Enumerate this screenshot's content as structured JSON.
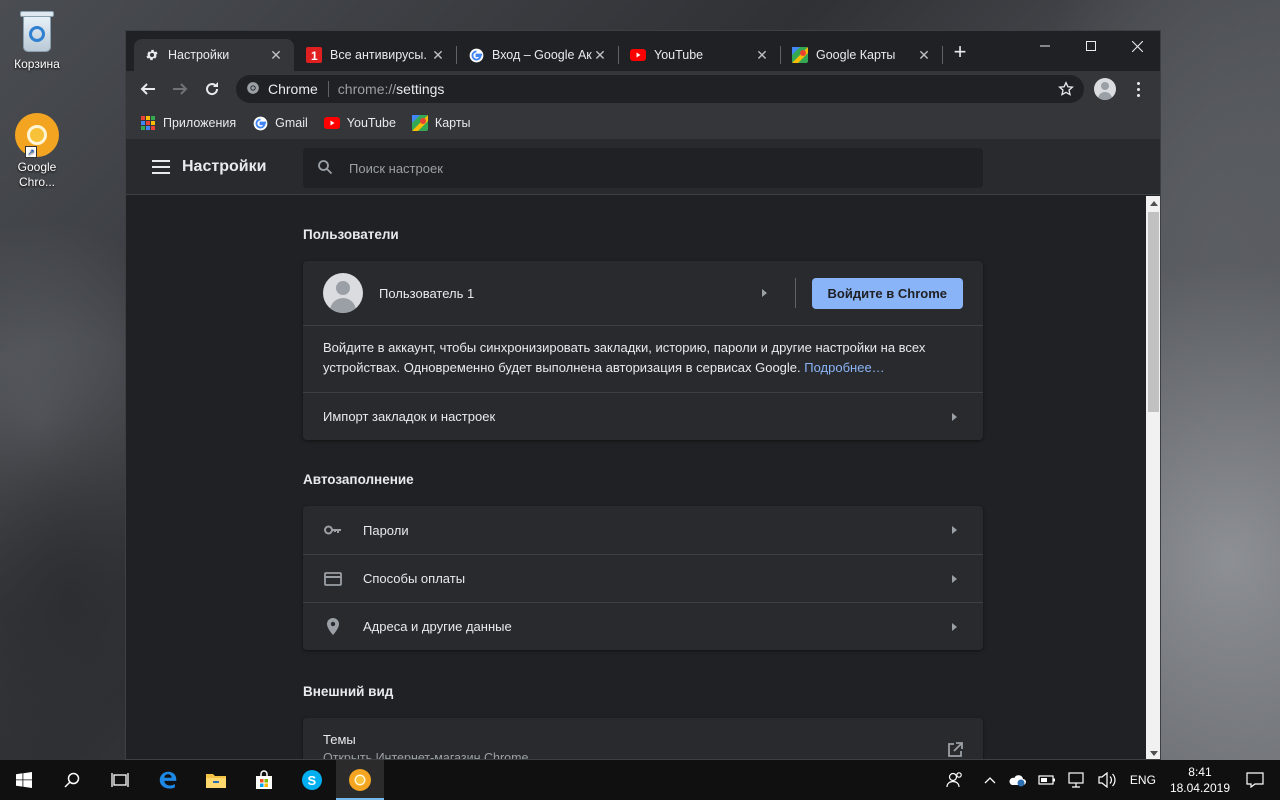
{
  "desktop": {
    "icons": [
      {
        "label": "Корзина"
      },
      {
        "label": "Google Chro..."
      }
    ]
  },
  "browser": {
    "tabs": [
      {
        "title": "Настройки",
        "active": true,
        "icon": "gear-icon"
      },
      {
        "title": "Все антивирусы. С",
        "active": false,
        "icon": "antivirus-site-icon"
      },
      {
        "title": "Вход – Google Ак",
        "active": false,
        "icon": "google-icon"
      },
      {
        "title": "YouTube",
        "active": false,
        "icon": "youtube-icon"
      },
      {
        "title": "Google Карты",
        "active": false,
        "icon": "maps-icon"
      }
    ],
    "omnibox": {
      "chip": "Chrome",
      "url_scheme": "chrome://",
      "url_path": "settings"
    },
    "bookmarks": [
      {
        "label": "Приложения",
        "icon": "apps-grid-icon"
      },
      {
        "label": "Gmail",
        "icon": "google-icon"
      },
      {
        "label": "YouTube",
        "icon": "youtube-icon"
      },
      {
        "label": "Карты",
        "icon": "maps-icon"
      }
    ]
  },
  "settings": {
    "title": "Настройки",
    "search_placeholder": "Поиск настроек",
    "people": {
      "section_title": "Пользователи",
      "user_name": "Пользователь 1",
      "signin_button": "Войдите в Chrome",
      "description": "Войдите в аккаунт, чтобы синхронизировать закладки, историю, пароли и другие настройки на всех устройствах. Одновременно будет выполнена авторизация в сервисах Google.",
      "learn_more": "Подробнее…",
      "import_label": "Импорт закладок и настроек"
    },
    "autofill": {
      "section_title": "Автозаполнение",
      "items": [
        {
          "label": "Пароли",
          "icon": "key-icon"
        },
        {
          "label": "Способы оплаты",
          "icon": "credit-card-icon"
        },
        {
          "label": "Адреса и другие данные",
          "icon": "location-pin-icon"
        }
      ]
    },
    "appearance": {
      "section_title": "Внешний вид",
      "themes_label": "Темы",
      "themes_sub": "Открыть Интернет-магазин Chrome"
    }
  },
  "taskbar": {
    "language": "ENG",
    "time": "8:41",
    "date": "18.04.2019"
  },
  "colors": {
    "accent": "#8ab4f8",
    "page_bg": "#202124",
    "card_bg": "#292a2d",
    "toolbar_bg": "#35363a"
  }
}
